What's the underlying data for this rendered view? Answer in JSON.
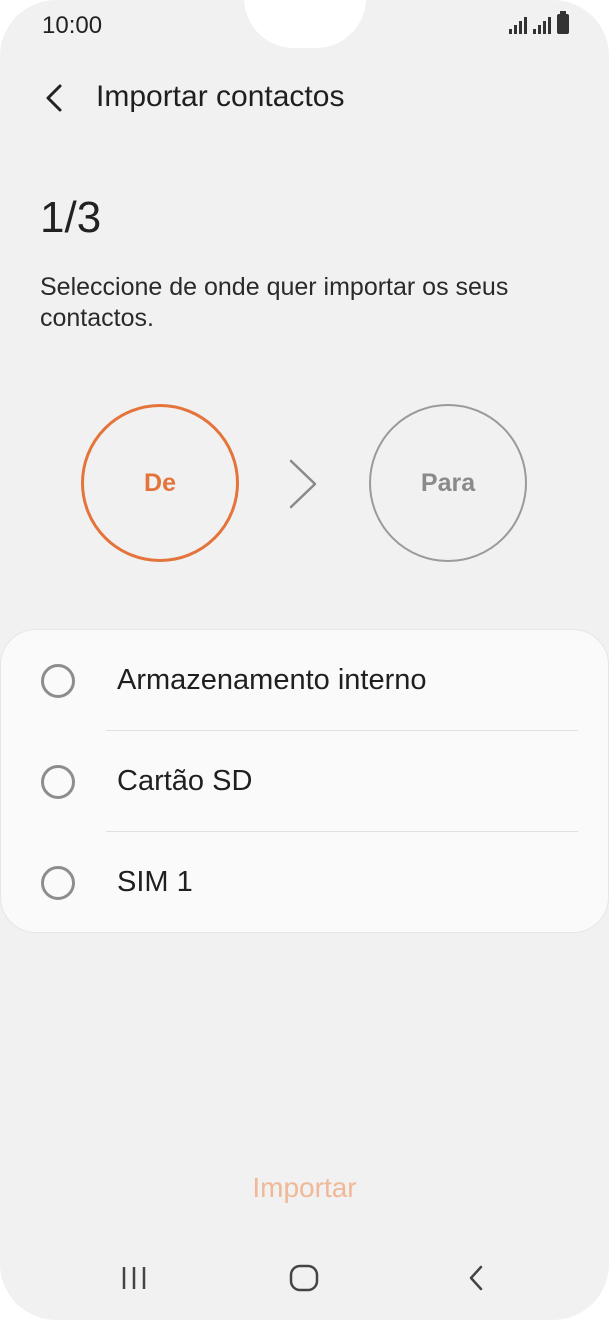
{
  "status_bar": {
    "time": "10:00",
    "icons": [
      "signal-icon",
      "signal-icon",
      "battery-icon"
    ]
  },
  "header": {
    "title": "Importar contactos",
    "back_icon": "chevron-left-icon"
  },
  "wizard": {
    "step": "1/3",
    "description": "Seleccione de onde quer importar os seus contactos.",
    "from_label": "De",
    "to_label": "Para",
    "arrow_icon": "chevron-right-icon"
  },
  "sources": [
    {
      "label": "Armazenamento interno",
      "selected": false
    },
    {
      "label": "Cartão SD",
      "selected": false
    },
    {
      "label": "SIM 1",
      "selected": false
    }
  ],
  "actions": {
    "import_label": "Importar"
  },
  "nav_bar": [
    "recents-icon",
    "home-icon",
    "back-icon"
  ],
  "colors": {
    "accent": "#e4743b",
    "import_disabled": "#f0b896",
    "background": "#f1f1f1"
  }
}
